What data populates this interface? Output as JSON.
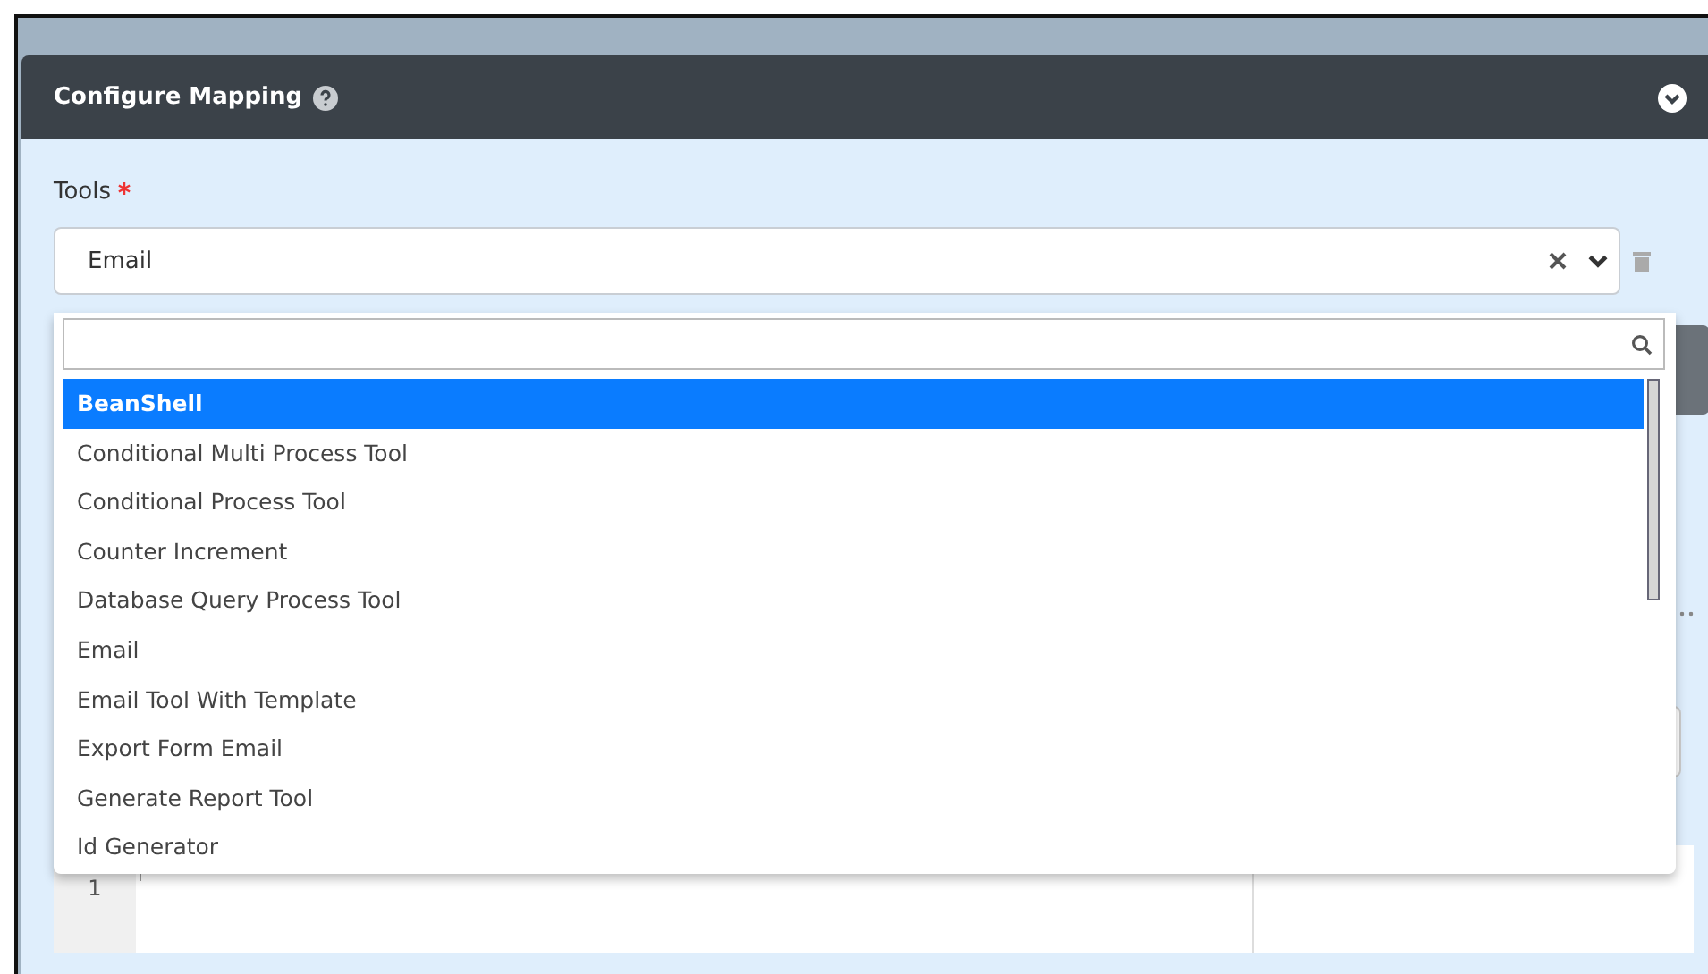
{
  "panel": {
    "title": "Configure Mapping",
    "expanded": true
  },
  "field": {
    "label": "Tools",
    "required": true,
    "value": "Email"
  },
  "dropdown": {
    "open": true,
    "options": [
      {
        "label": "BeanShell",
        "selected": true
      },
      {
        "label": "Conditional Multi Process Tool",
        "selected": false
      },
      {
        "label": "Conditional Process Tool",
        "selected": false
      },
      {
        "label": "Counter Increment",
        "selected": false
      },
      {
        "label": "Database Query Process Tool",
        "selected": false
      },
      {
        "label": "Email",
        "selected": false
      },
      {
        "label": "Email Tool With Template",
        "selected": false
      },
      {
        "label": "Export Form Email",
        "selected": false
      },
      {
        "label": "Generate Report Tool",
        "selected": false
      },
      {
        "label": "Id Generator",
        "selected": false
      }
    ]
  },
  "editor": {
    "line_numbers": [
      "1"
    ]
  }
}
